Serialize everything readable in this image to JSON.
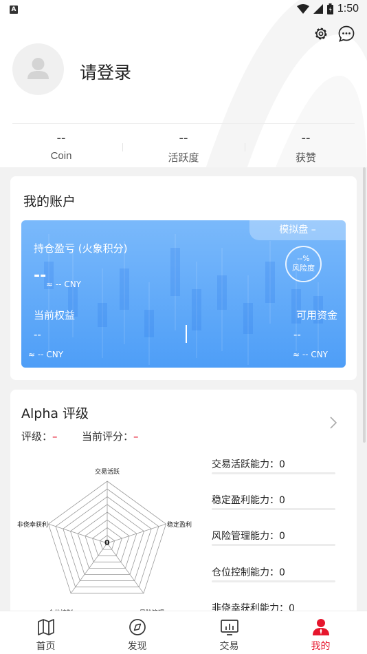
{
  "status": {
    "time": "1:50",
    "badge": "A"
  },
  "profile": {
    "login_label": "请登录"
  },
  "stats": [
    {
      "value": "--",
      "label": "Coin"
    },
    {
      "value": "--",
      "label": "活跃度"
    },
    {
      "value": "--",
      "label": "获赞"
    }
  ],
  "account": {
    "title": "我的账户",
    "sim_tag": "模拟盘 –",
    "pnl_label": "持仓盈亏 (火象积分)",
    "pnl_value": "--",
    "pnl_cny": "≈ -- CNY",
    "risk_value": "--%",
    "risk_label": "风险度",
    "equity_label": "当前权益",
    "equity_value": "--",
    "equity_cny": "≈ -- CNY",
    "available_label": "可用资金",
    "available_value": "--",
    "available_cny": "≈ -- CNY"
  },
  "alpha": {
    "title": "Alpha 评级",
    "rating_label": "评级：",
    "rating_value": "–",
    "score_label": "当前评分：",
    "score_value": "–",
    "radar_axes": [
      "交易活跃",
      "稳定盈利",
      "风险管理",
      "仓位控制",
      "非侥幸获利"
    ],
    "radar_center": "0",
    "abilities": [
      {
        "label": "交易活跃能力：",
        "value": "0"
      },
      {
        "label": "稳定盈利能力：",
        "value": "0"
      },
      {
        "label": "风险管理能力：",
        "value": "0"
      },
      {
        "label": "仓位控制能力：",
        "value": "0"
      },
      {
        "label": "非侥幸获利能力：",
        "value": "0"
      }
    ]
  },
  "tabs": [
    {
      "label": "首页",
      "icon": "book-map-icon"
    },
    {
      "label": "发现",
      "icon": "compass-icon"
    },
    {
      "label": "交易",
      "icon": "chart-icon"
    },
    {
      "label": "我的",
      "icon": "user-icon",
      "active": true
    }
  ],
  "colors": {
    "accent_red": "#e6162d",
    "panel_blue": "#5aa7f8"
  }
}
